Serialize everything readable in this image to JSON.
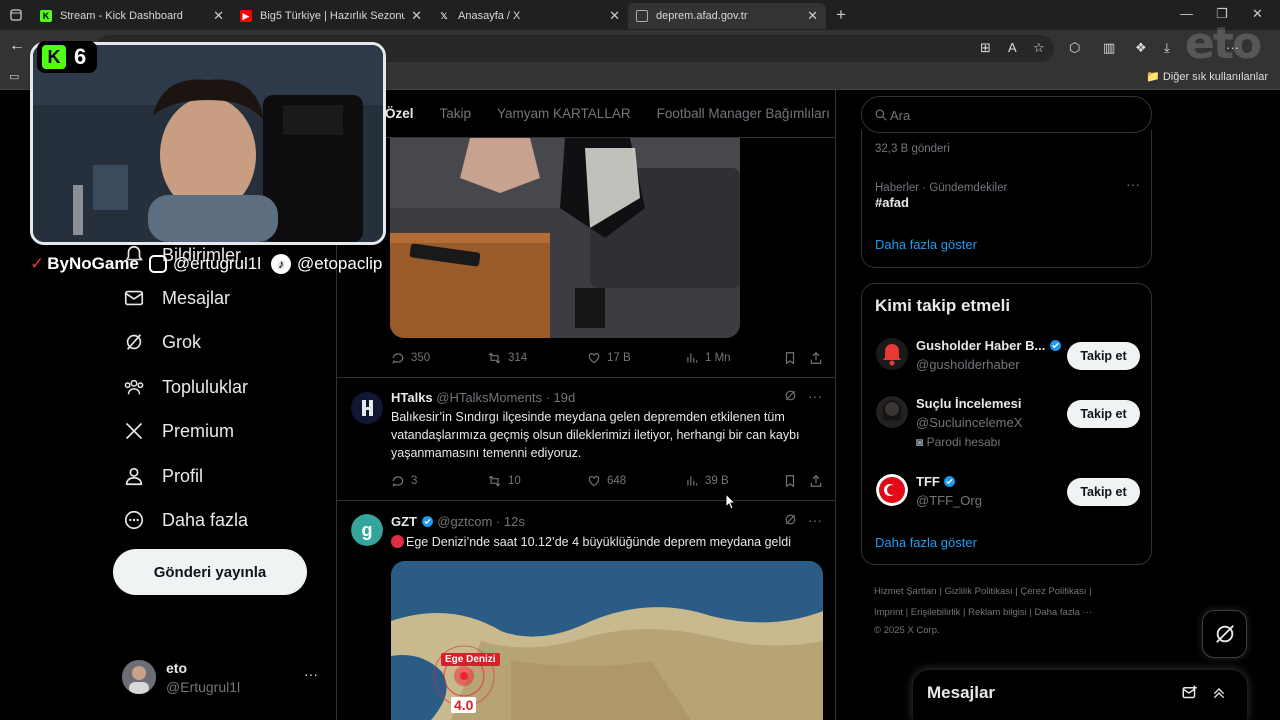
{
  "browser": {
    "tabs": [
      {
        "title": "Stream - Kick Dashboard",
        "favicon": "kick-icon",
        "color": "#53fc18"
      },
      {
        "title": "Big5 Türkiye | Hazırlık Sezonu 2. B",
        "favicon": "youtube-icon",
        "color": "#ff0000"
      },
      {
        "title": "Anasayfa / X",
        "favicon": "x-icon",
        "color": "#000000"
      },
      {
        "title": "deprem.afad.gov.tr",
        "favicon": "page-icon",
        "color": "#444444"
      }
    ],
    "bookmarks_folder": "Diğer sık kullanılanlar"
  },
  "nav": {
    "notifications": "Bildirimler",
    "messages": "Mesajlar",
    "grok": "Grok",
    "communities": "Topluluklar",
    "premium": "Premium",
    "profile": "Profil",
    "more": "Daha fazla",
    "post_button": "Gönderi yayınla",
    "account": {
      "name": "eto",
      "handle": "@Ertugrul1l",
      "more": "···"
    }
  },
  "feed": {
    "tabs": [
      "Özel",
      "Takip",
      "Yamyam KARTALLAR",
      "Football Manager Bağımlıları"
    ],
    "tweets": [
      {
        "replies": "350",
        "reposts": "314",
        "likes": "17 B",
        "views": "1 Mn"
      },
      {
        "name": "HTalks",
        "handle": "@HTalksMoments · 19d",
        "text": "Balıkesir’in Sındırgı ilçesinde meydana gelen depremden etkilenen tüm vatandaşlarımıza geçmiş olsun dileklerimizi iletiyor, herhangi bir can kaybı yaşanmamasını temenni ediyoruz.",
        "replies": "3",
        "reposts": "10",
        "likes": "648",
        "views": "39 B"
      },
      {
        "name": "GZT",
        "handle": "@gztcom · 12s",
        "text": "Ege Denizi’nde saat 10.12’de 4 büyüklüğünde deprem meydana geldi",
        "map_label": "Ege Denizi",
        "magnitude": "4.0"
      }
    ]
  },
  "right": {
    "search_placeholder": "Ara",
    "trend_count": "32,3 B gönderi",
    "trend_category": "Haberler · Gündemdekiler",
    "trend_name": "#afad",
    "show_more": "Daha fazla göster",
    "who_to_follow_title": "Kimi takip etmeli",
    "follow_button": "Takip et",
    "suggestions": [
      {
        "name": "Gusholder Haber B...",
        "handle": "@gusholderhaber",
        "verified": true
      },
      {
        "name": "Suçlu İncelemesi",
        "handle": "@SucluincelemeX",
        "note": "Parodi hesabı"
      },
      {
        "name": "TFF",
        "handle": "@TFF_Org",
        "verified": true
      }
    ],
    "footer_line1": "Hizmet Şartları  |   Gizlilik Politikası  |   Çerez Politikası  |",
    "footer_line2": "Imprint  |   Erişilebilirlik  |   Reklam bilgisi  |   Daha fazla ···",
    "footer_line3": "© 2025 X Corp.",
    "messages_drawer": "Mesajlar"
  },
  "overlay": {
    "channel_badge": "6",
    "handle_bynogame": "ByNoGame",
    "handle_instagram": "@ertugrul1l",
    "handle_tiktok": "@etopaclip",
    "watermark": "eto"
  },
  "colors": {
    "accent": "#1d9bf0",
    "kick_green": "#53fc18",
    "verified": "#1d9bf0",
    "bg": "#000000"
  }
}
